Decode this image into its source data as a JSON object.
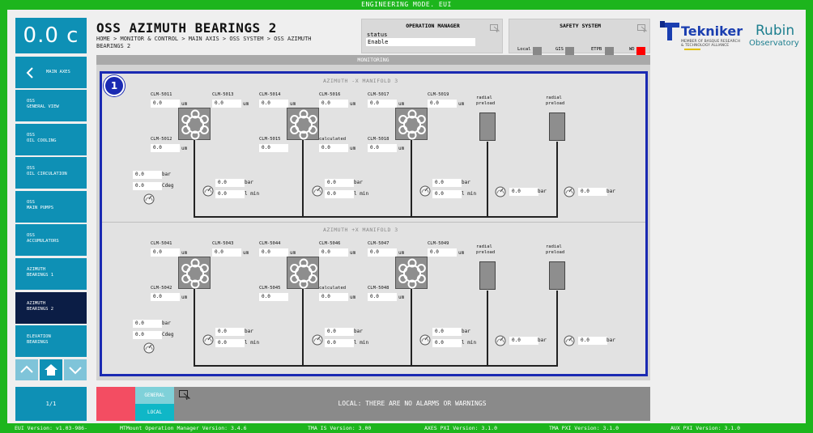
{
  "topbar": {
    "title": "ENGINEERING MODE. EUI"
  },
  "left": {
    "temp": "0.0 c",
    "back_label": "MAIN AXES",
    "items": [
      {
        "label": "OSS\nGENERAL VIEW"
      },
      {
        "label": "OSS\nOIL COOLING"
      },
      {
        "label": "OSS\nOIL CIRCULATION"
      },
      {
        "label": "OSS\nMAIN PUMPS"
      },
      {
        "label": "OSS\nACCUMULATORS"
      },
      {
        "label": "AZIMUTH\nBEARINGS 1"
      },
      {
        "label": "AZIMUTH\nBEARINGS 2"
      },
      {
        "label": "ELEVATION\nBEARINGS"
      }
    ],
    "page": "1/1"
  },
  "header": {
    "title": "OSS AZIMUTH BEARINGS 2",
    "breadcrumb": "HOME > MONITOR & CONTROL > MAIN AXIS > OSS SYSTEM > OSS AZIMUTH BEARINGS 2"
  },
  "opmgr": {
    "title": "OPERATION MANAGER",
    "status_label": "status",
    "status_value": "Enable"
  },
  "safety": {
    "title": "SAFETY SYSTEM",
    "labels": [
      "Local",
      "GIS",
      "ETPB",
      "WD"
    ]
  },
  "logo": {
    "tekniker": "Tekniker",
    "tek_sub": "MEMBER OF BASQUE RESEARCH\n& TECHNOLOGY ALLIANCE",
    "rubin1": "Rubin",
    "rubin2": "Observatory"
  },
  "monitor": {
    "header": "MONITORING",
    "badge": "1",
    "manifolds": [
      {
        "title": "AZIMUTH -X MANIFOLD 3",
        "clm": [
          "CLM-5011",
          "CLM-5013",
          "CLM-5014",
          "CLM-5016",
          "CLM-5017",
          "CLM-5019",
          "CLM-5012",
          "CLM-5015",
          "CLM-5018"
        ],
        "clm_vals": [
          "0.0",
          "0.0",
          "0.0",
          "0.0",
          "0.0",
          "0.0",
          "0.0",
          "0.0",
          "0.0"
        ],
        "calc_label": "calculated",
        "radial": "radial\npreload",
        "temp_vals": [
          "0.0",
          "0.0"
        ],
        "flow_vals": [
          "0.0",
          "0.0",
          "0.0",
          "0.0",
          "0.0",
          "0.0",
          "0.0",
          "0.0"
        ]
      },
      {
        "title": "AZIMUTH +X MANIFOLD 3",
        "clm": [
          "CLM-5041",
          "CLM-5043",
          "CLM-5044",
          "CLM-5046",
          "CLM-5047",
          "CLM-5049",
          "CLM-5042",
          "CLM-5045",
          "CLM-5048"
        ],
        "clm_vals": [
          "0.0",
          "0.0",
          "0.0",
          "0.0",
          "0.0",
          "0.0",
          "0.0",
          "0.0",
          "0.0"
        ],
        "calc_label": "calculated",
        "radial": "radial\npreload",
        "temp_vals": [
          "0.0",
          "0.0"
        ],
        "flow_vals": [
          "0.0",
          "0.0",
          "0.0",
          "0.0",
          "0.0",
          "0.0",
          "0.0",
          "0.0"
        ]
      }
    ],
    "units": {
      "um": "um",
      "bar": "bar",
      "cdeg": "Cdeg",
      "lmin": "l min"
    }
  },
  "footer": {
    "general": "GENERAL",
    "local": "LOCAL",
    "alarm": "LOCAL: THERE ARE NO ALARMS OR WARNINGS"
  },
  "versions": {
    "eui": "EUI Version: v1.03-986-",
    "mtmount": "MTMount Operation Manager Version: 3.4.6",
    "tma_is": "TMA IS Version: 3.00",
    "axes": "AXES PXI Version: 3.1.0",
    "tma_pxi": "TMA PXI Version: 3.1.0",
    "aux": "AUX PXI Version: 3.1.0"
  },
  "colors": {
    "accent": "#0e90b5",
    "active": "#0b1d45",
    "alarm": "#f34d62",
    "frame": "#1a2ab2",
    "green": "#1db51d",
    "wd": "#ff0000"
  }
}
